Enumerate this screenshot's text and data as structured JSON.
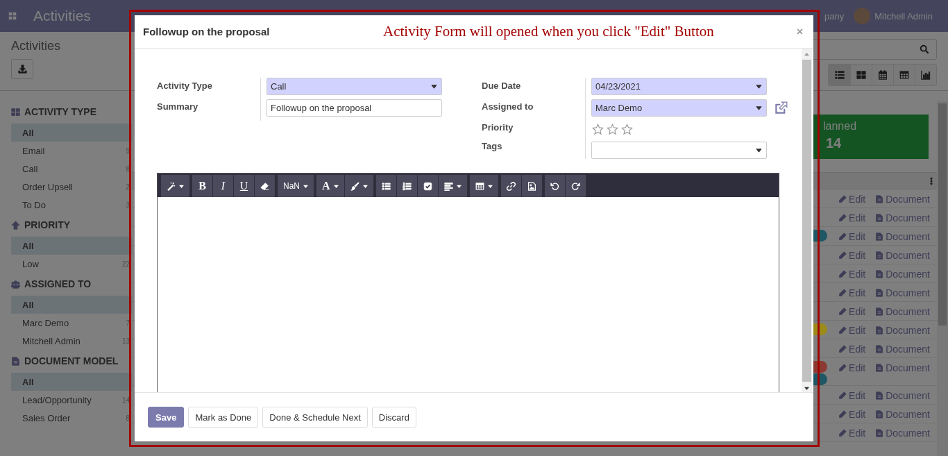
{
  "navbar": {
    "title": "Activities",
    "company": "pany",
    "user": "Mitchell Admin"
  },
  "control_panel": {
    "breadcrumb": "Activities",
    "views": [
      {
        "kind": "list",
        "selected": true
      },
      {
        "kind": "kanban",
        "selected": false
      },
      {
        "kind": "calendar",
        "selected": false
      },
      {
        "kind": "pivot",
        "selected": false
      },
      {
        "kind": "graph",
        "selected": false
      }
    ]
  },
  "sidebar": {
    "sections": [
      {
        "kind": "type",
        "title": "ACTIVITY TYPE",
        "items": [
          {
            "label": "All",
            "selected": true
          },
          {
            "label": "Email",
            "count": "9",
            "selected": false
          },
          {
            "label": "Call",
            "count": "8",
            "selected": false
          },
          {
            "label": "Order Upsell",
            "count": "2",
            "selected": false
          },
          {
            "label": "To Do",
            "count": "3",
            "selected": false
          }
        ]
      },
      {
        "kind": "priority",
        "title": "PRIORITY",
        "items": [
          {
            "label": "All",
            "selected": true
          },
          {
            "label": "Low",
            "count": "22",
            "selected": false
          }
        ]
      },
      {
        "kind": "users",
        "title": "ASSIGNED TO",
        "items": [
          {
            "label": "All",
            "selected": true
          },
          {
            "label": "Marc Demo",
            "count": "7",
            "selected": false
          },
          {
            "label": "Mitchell Admin",
            "count": "13",
            "selected": false
          }
        ]
      },
      {
        "kind": "document",
        "title": "DOCUMENT MODEL",
        "items": [
          {
            "label": "All",
            "selected": true
          },
          {
            "label": "Lead/Opportunity",
            "count": "14",
            "selected": false
          },
          {
            "label": "Sales Order",
            "count": "8",
            "selected": false
          }
        ]
      }
    ]
  },
  "summary_card": {
    "label": "lanned",
    "value": "14"
  },
  "table": {
    "rows": [
      {
        "edit": "Edit",
        "document": "Document"
      },
      {
        "edit": "Edit",
        "document": "Document"
      },
      {
        "edit": "Edit",
        "document": "Document",
        "tags": [
          {
            "color": "#1e5866"
          }
        ]
      },
      {
        "edit": "Edit",
        "document": "Document"
      },
      {
        "edit": "Edit",
        "document": "Document"
      },
      {
        "edit": "Edit",
        "document": "Document"
      },
      {
        "edit": "Edit",
        "document": "Document"
      },
      {
        "edit": "Edit",
        "document": "Document",
        "tags": [
          {
            "color": "#9c8a1a"
          }
        ]
      },
      {
        "edit": "Edit",
        "document": "Document"
      },
      {
        "edit": "Edit",
        "document": "Document",
        "tags": [
          {
            "color": "#8a3a32"
          },
          {
            "color": "#1e5866"
          }
        ]
      },
      {
        "edit": "Edit",
        "document": "Document"
      },
      {
        "edit": "Edit",
        "document": "Document"
      },
      {
        "edit": "Edit",
        "document": "Document"
      }
    ]
  },
  "dialog": {
    "title": "Followup on the proposal",
    "annotation": "Activity Form will opened when you click \"Edit\" Button",
    "left_fields": [
      {
        "label": "Activity Type",
        "kind": "select",
        "value": "Call",
        "required": true
      },
      {
        "label": "Summary",
        "kind": "text",
        "value": "Followup on the proposal",
        "required": false
      }
    ],
    "right_fields": [
      {
        "label": "Due Date",
        "kind": "select",
        "value": "04/23/2021",
        "required": true
      },
      {
        "label": "Assigned to",
        "kind": "select",
        "value": "Marc Demo",
        "required": true,
        "external_link": true
      },
      {
        "label": "Priority",
        "kind": "stars",
        "stars": 0
      },
      {
        "label": "Tags",
        "kind": "select",
        "required": false
      }
    ],
    "toolbar": [
      [
        {
          "kind": "magic",
          "caret": true
        }
      ],
      [
        {
          "kind": "bold",
          "text": "B"
        },
        {
          "kind": "italic",
          "text": "I"
        },
        {
          "kind": "underline",
          "text": "U"
        },
        {
          "kind": "eraser"
        }
      ],
      [
        {
          "kind": "font_size",
          "text": "NaN",
          "caret": true
        }
      ],
      [
        {
          "kind": "font_color",
          "text": "A",
          "caret": true
        },
        {
          "kind": "brush",
          "caret": true
        }
      ],
      [
        {
          "kind": "ul"
        },
        {
          "kind": "ol"
        },
        {
          "kind": "check"
        },
        {
          "kind": "align",
          "caret": true
        }
      ],
      [
        {
          "kind": "table",
          "caret": true
        }
      ],
      [
        {
          "kind": "link"
        },
        {
          "kind": "image"
        }
      ],
      [
        {
          "kind": "undo"
        },
        {
          "kind": "redo"
        }
      ]
    ],
    "buttons": [
      {
        "label": "Save",
        "kind": "primary"
      },
      {
        "label": "Mark as Done",
        "kind": "secondary"
      },
      {
        "label": "Done & Schedule Next",
        "kind": "secondary"
      },
      {
        "label": "Discard",
        "kind": "secondary"
      }
    ]
  }
}
